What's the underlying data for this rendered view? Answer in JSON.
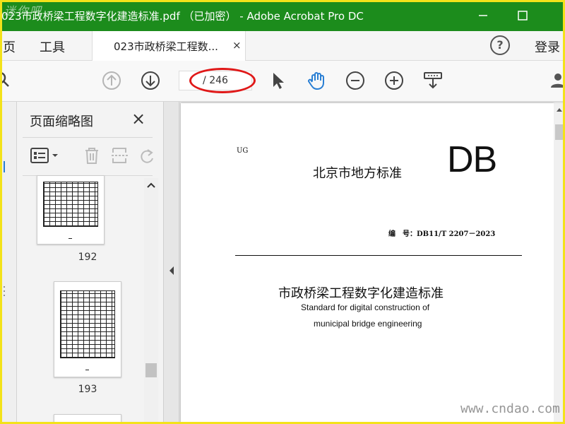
{
  "window": {
    "title": "023市政桥梁工程数字化建造标准.pdf （已加密） - Adobe Acrobat Pro DC",
    "watermark": "迷你吧"
  },
  "menu": {
    "home_label": "页",
    "tools_label": "工具",
    "doc_tab_label": "023市政桥梁工程数...",
    "close_glyph": "×",
    "help_glyph": "?",
    "login_label": "登录"
  },
  "toolbar": {
    "page_indicator": "/ 246"
  },
  "thumbnails_panel": {
    "title": "页面缩略图",
    "close_glyph": "×",
    "pages": [
      {
        "number": "192"
      },
      {
        "number": "193"
      }
    ]
  },
  "document": {
    "code_prefix": "UG",
    "standard_cn": "北京市地方标准",
    "logo": "DB",
    "standard_number": "编　号：DB11/T 2207－2023",
    "title_cn": "市政桥梁工程数字化建造标准",
    "title_en_line1": "Standard for digital construction of",
    "title_en_line2": "municipal bridge engineering"
  },
  "site_watermark": "www.cndao.com",
  "colors": {
    "titlebar": "#1c8c1c",
    "accent_blue": "#2a7fd4",
    "annotation_red": "#e01818",
    "frame_yellow": "#f3e21a"
  }
}
